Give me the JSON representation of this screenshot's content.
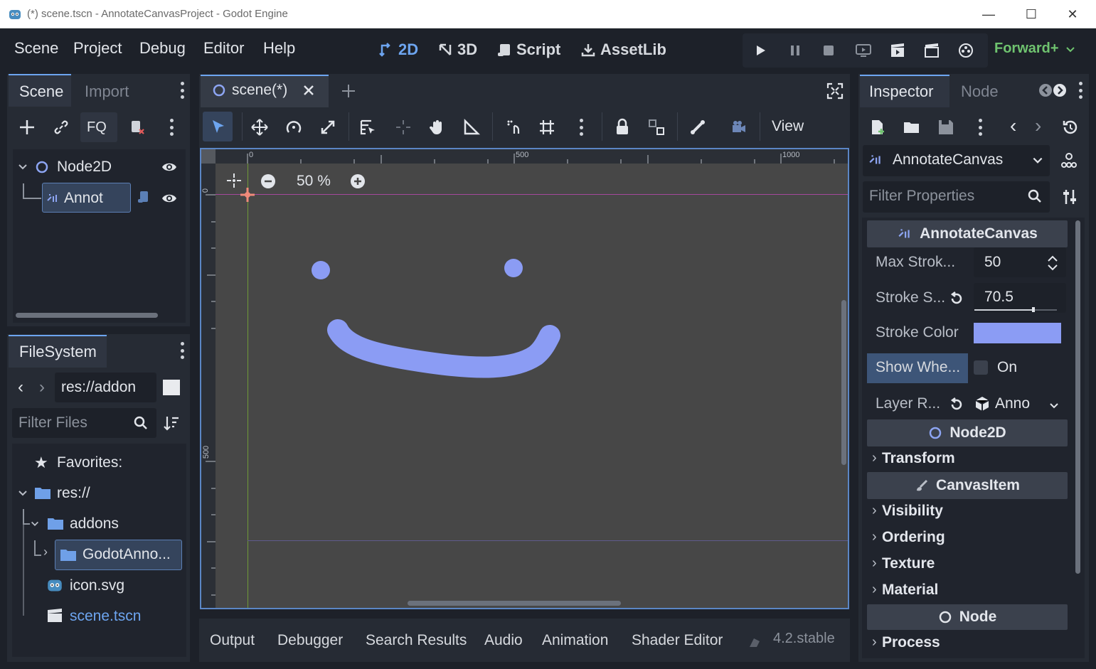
{
  "window": {
    "title": "(*) scene.tscn - AnnotateCanvasProject - Godot Engine",
    "controls": [
      "—",
      "☐",
      "✕"
    ]
  },
  "menu": [
    "Scene",
    "Project",
    "Debug",
    "Editor",
    "Help"
  ],
  "workspaces": [
    {
      "label": "2D",
      "icon": "2d-icon",
      "active": true
    },
    {
      "label": "3D",
      "icon": "3d-icon",
      "active": false
    },
    {
      "label": "Script",
      "icon": "script-icon",
      "active": false
    },
    {
      "label": "AssetLib",
      "icon": "assetlib-icon",
      "active": false
    }
  ],
  "renderer": "Forward+",
  "scene_dock": {
    "tabs": [
      "Scene",
      "Import"
    ],
    "filter_label": "FQ",
    "tree": [
      {
        "label": "Node2D",
        "icon": "node2d-icon"
      },
      {
        "label": "Annot",
        "icon": "annotate-canvas-icon",
        "selected": true
      }
    ]
  },
  "filesystem": {
    "tab": "FileSystem",
    "path": "res://addon",
    "filter_placeholder": "Filter Files",
    "favorites": "Favorites:",
    "items": [
      {
        "label": "res://",
        "icon": "folder-icon"
      },
      {
        "label": "addons",
        "icon": "folder-icon"
      },
      {
        "label": "GodotAnno...",
        "icon": "folder-icon",
        "selected": true
      },
      {
        "label": "icon.svg",
        "icon": "godot-icon"
      },
      {
        "label": "scene.tscn",
        "icon": "clapper-icon"
      }
    ]
  },
  "editor": {
    "tab": "scene(*)",
    "toolbar_view": "View",
    "zoom": "50 %",
    "ruler": {
      "h": [
        "0",
        "500",
        "1000"
      ],
      "v": [
        "0",
        "500"
      ]
    },
    "colors": {
      "stroke": "#8b9cf4",
      "canvas": "#474747"
    }
  },
  "inspector": {
    "tabs": [
      "Inspector",
      "Node"
    ],
    "object": "AnnotateCanvas",
    "filter_placeholder": "Filter Properties",
    "section_main": "AnnotateCanvas",
    "props": {
      "max_strokes": {
        "label": "Max Strok...",
        "value": "50"
      },
      "stroke_size": {
        "label": "Stroke S...",
        "value": "70.5",
        "level": 0.7
      },
      "stroke_color": {
        "label": "Stroke Color",
        "color": "#8b9cf4"
      },
      "show_when": {
        "label": "Show Whe...",
        "value": "On"
      },
      "layer": {
        "label": "Layer R...",
        "value": "Anno"
      }
    },
    "section_node2d": "Node2D",
    "cat_transform": "Transform",
    "section_canvasitem": "CanvasItem",
    "cats_canvasitem": [
      "Visibility",
      "Ordering",
      "Texture",
      "Material"
    ],
    "section_node": "Node",
    "cat_process": "Process"
  },
  "bottom": {
    "tabs": [
      "Output",
      "Debugger",
      "Search Results",
      "Audio",
      "Animation",
      "Shader Editor"
    ],
    "version": "4.2.stable"
  }
}
